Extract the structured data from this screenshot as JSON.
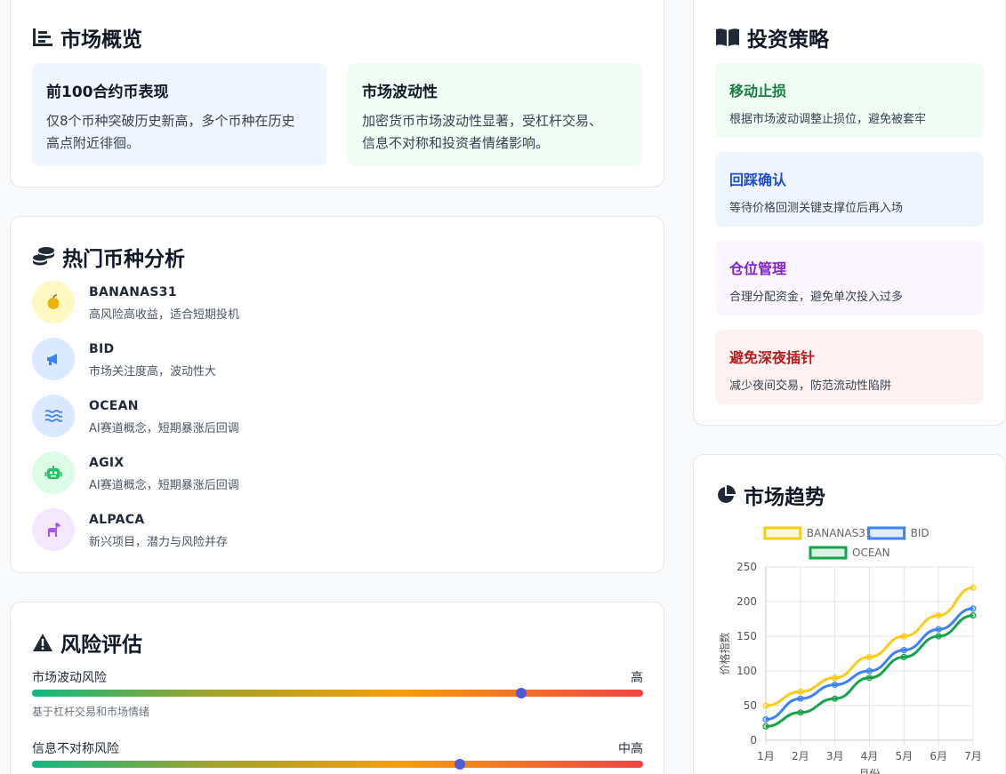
{
  "overview": {
    "title": "市场概览",
    "cards": [
      {
        "title": "前100合约币表现",
        "line1": "仅8个币种突破历史新高，多个币种在历史",
        "line2": "高点附近徘徊。"
      },
      {
        "title": "市场波动性",
        "line1": "加密货币市场波动性显著，受杠杆交易、",
        "line2": "信息不对称和投资者情绪影响。"
      }
    ]
  },
  "coins": {
    "title": "热门币种分析",
    "items": [
      {
        "name": "BANANAS31",
        "desc": "高风险高收益，适合短期投机",
        "icon": "apple-icon"
      },
      {
        "name": "BID",
        "desc": "市场关注度高，波动性大",
        "icon": "megaphone-icon"
      },
      {
        "name": "OCEAN",
        "desc": "AI赛道概念，短期暴涨后回调",
        "icon": "water-icon"
      },
      {
        "name": "AGIX",
        "desc": "AI赛道概念，短期暴涨后回调",
        "icon": "robot-icon"
      },
      {
        "name": "ALPACA",
        "desc": "新兴项目，潜力与风险并存",
        "icon": "horse-icon"
      }
    ]
  },
  "risk": {
    "title": "风险评估",
    "rows": [
      {
        "label": "市场波动风险",
        "level": "高",
        "note": "基于杠杆交易和市场情绪",
        "value": 0.8
      },
      {
        "label": "信息不对称风险",
        "level": "中高",
        "note": "",
        "value": 0.7
      }
    ]
  },
  "strategy": {
    "title": "投资策略",
    "items": [
      {
        "title": "移动止损",
        "desc": "根据市场波动调整止损位，避免被套牢",
        "color": "#15803d",
        "bg": "#f0fdf4"
      },
      {
        "title": "回踩确认",
        "desc": "等待价格回测关键支撑位后再入场",
        "color": "#1d4ed8",
        "bg": "#eff6ff"
      },
      {
        "title": "仓位管理",
        "desc": "合理分配资金，避免单次投入过多",
        "color": "#7e22ce",
        "bg": "#faf5ff"
      },
      {
        "title": "避免深夜插针",
        "desc": "减少夜间交易，防范流动性陷阱",
        "color": "#b91c1c",
        "bg": "#fef2f2"
      }
    ]
  },
  "trend": {
    "title": "市场趋势",
    "chart_data": {
      "type": "line",
      "x": [
        "1月",
        "2月",
        "3月",
        "4月",
        "5月",
        "6月",
        "7月"
      ],
      "xlabel": "月份",
      "ylabel": "价格指数",
      "ylim": [
        0,
        250
      ],
      "yticks": [
        0,
        50,
        100,
        150,
        200,
        250
      ],
      "grid": true,
      "legend": "top",
      "series": [
        {
          "name": "BANANAS31",
          "values": [
            50,
            70,
            90,
            120,
            150,
            180,
            220
          ],
          "color": "#facc15"
        },
        {
          "name": "BID",
          "values": [
            30,
            60,
            80,
            100,
            130,
            160,
            190
          ],
          "color": "#3b82f6"
        },
        {
          "name": "OCEAN",
          "values": [
            20,
            40,
            60,
            90,
            120,
            150,
            180
          ],
          "color": "#16a34a"
        }
      ]
    }
  }
}
